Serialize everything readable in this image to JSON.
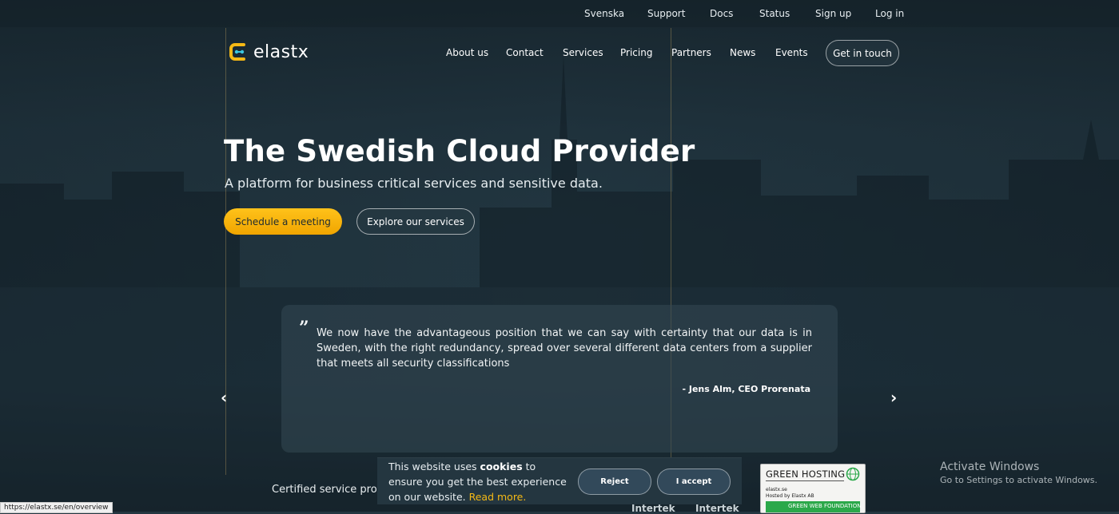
{
  "topbar": {
    "links": [
      "Svenska",
      "Support",
      "Docs",
      "Status",
      "Sign up",
      "Log in"
    ]
  },
  "brand": {
    "name": "elastx",
    "accent": "#f5b915"
  },
  "nav": {
    "items": [
      "About us",
      "Contact",
      "Services",
      "Pricing",
      "Partners",
      "News",
      "Events"
    ],
    "cta": "Get in touch"
  },
  "hero": {
    "title": "The Swedish Cloud Provider",
    "subtitle": "A platform for business critical services and sensitive data.",
    "primary_button": "Schedule a meeting",
    "secondary_button": "Explore our services"
  },
  "testimonial": {
    "quote_mark": "”",
    "text": "We now have the advantageous position that we can say with certainty that our data is in Sweden, with the right redundancy, spread over several different data centers from a supplier that meets all security classifications",
    "author": "- Jens Alm, CEO Prorenata",
    "prev_icon": "chevron-left-icon",
    "next_icon": "chevron-right-icon",
    "prev_glyph": "‹",
    "next_glyph": "›"
  },
  "certified": {
    "label": "Certified service provid",
    "logos": [
      "Intertek",
      "Intertek"
    ]
  },
  "cookie_banner": {
    "text_before": "This website uses ",
    "text_bold": "cookies",
    "text_after": " to ensure you get the best experience on our website. ",
    "link": "Read more.",
    "reject": "Reject",
    "accept": "I accept"
  },
  "green_badge": {
    "title": "GREEN HOSTING",
    "domain": "elastx.se",
    "hosted_by": "Hosted by Elastx AB",
    "foundation": "GREEN WEB FOUNDATION"
  },
  "windows_watermark": {
    "line1": "Activate Windows",
    "line2": "Go to Settings to activate Windows."
  },
  "status_bar": {
    "url": "https://elastx.se/en/overview"
  }
}
